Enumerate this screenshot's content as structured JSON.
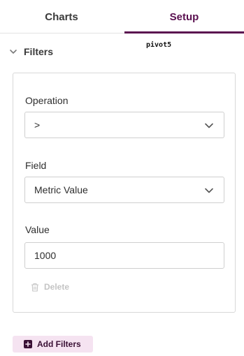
{
  "tabs": [
    {
      "label": "Charts",
      "active": false
    },
    {
      "label": "Setup",
      "active": true
    }
  ],
  "accent_color": "#5a1050",
  "section": {
    "title": "Filters",
    "expanded": true,
    "icon": "chevron-down-icon"
  },
  "floating_text": "pivot5",
  "filter": {
    "operation": {
      "label": "Operation",
      "value": ">"
    },
    "field": {
      "label": "Field",
      "value": "Metric Value"
    },
    "value": {
      "label": "Value",
      "value": "1000"
    },
    "delete_label": "Delete",
    "delete_icon": "trash-icon"
  },
  "add_button": {
    "label": "Add Filters",
    "icon": "plus-icon",
    "background": "#f5e3f1"
  }
}
